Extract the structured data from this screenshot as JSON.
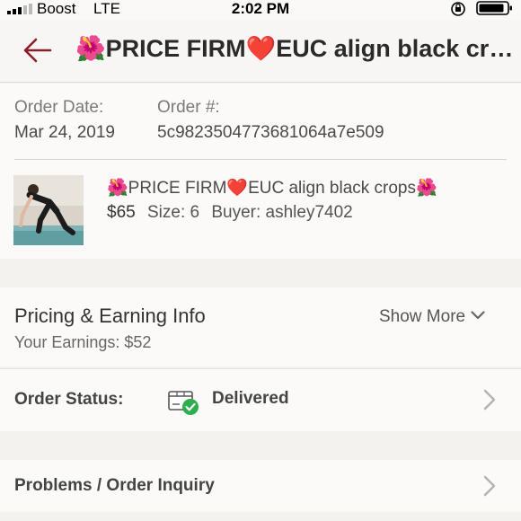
{
  "status_bar": {
    "carrier": "Boost",
    "network": "LTE",
    "time": "2:02 PM",
    "icons": [
      "signal-icon",
      "rotation-lock-icon",
      "battery-icon"
    ]
  },
  "nav": {
    "back_icon": "arrow-left-icon",
    "title": "🌺PRICE FIRM❤️EUC align black crops🌺"
  },
  "order": {
    "date_label": "Order Date:",
    "date_value": "Mar 24, 2019",
    "number_label": "Order #:",
    "number_value": "5c9823504773681064a7e509"
  },
  "item": {
    "title": "🌺PRICE FIRM❤️EUC align black crops🌺",
    "price": "$65",
    "size": "Size: 6",
    "buyer": "Buyer: ashley7402"
  },
  "pricing": {
    "title": "Pricing & Earning Info",
    "earnings": "Your Earnings: $52",
    "show_more": "Show More"
  },
  "order_status": {
    "label": "Order Status:",
    "value": "Delivered",
    "icon": "delivered-box-icon"
  },
  "problems": {
    "label": "Problems / Order Inquiry"
  },
  "colors": {
    "accent": "#8b1e2a",
    "delivered_check": "#2eae4e",
    "page_bg": "#f4f2ef",
    "card_bg": "#fbfaf8"
  }
}
